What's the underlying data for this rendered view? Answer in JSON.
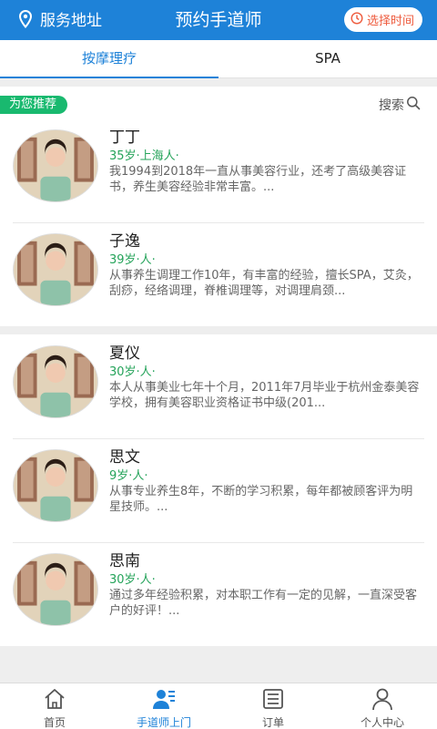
{
  "header": {
    "location_label": "服务地址",
    "title": "预约手道师",
    "time_button_label": "选择时间",
    "location_icon": "location-pin-icon",
    "clock_icon": "clock-icon",
    "accent_color": "#1e82d8"
  },
  "tabs": [
    {
      "label": "按摩理疗",
      "active": true
    },
    {
      "label": "SPA",
      "active": false
    }
  ],
  "recommend": {
    "badge_label": "为您推荐",
    "search_label": "搜索",
    "badge_color": "#19b96f"
  },
  "therapists": [
    {
      "name": "丁丁",
      "meta": "35岁·上海人·",
      "description": "我1994到2018年一直从事美容行业，还考了高级美容证书，养生美容经验非常丰富。..."
    },
    {
      "name": "子逸",
      "meta": "39岁·人·",
      "description": "从事养生调理工作10年，有丰富的经验，擅长SPA，艾灸，刮痧，经络调理，脊椎调理等，对调理肩颈..."
    },
    {
      "name": "夏仪",
      "meta": "30岁·人·",
      "description": "本人从事美业七年十个月，2011年7月毕业于杭州金泰美容学校，拥有美容职业资格证书中级(201..."
    },
    {
      "name": "思文",
      "meta": "9岁·人·",
      "description": "从事专业养生8年，不断的学习积累，每年都被顾客评为明星技师。..."
    },
    {
      "name": "思南",
      "meta": "30岁·人·",
      "description": "通过多年经验积累，对本职工作有一定的见解，一直深受客户的好评！..."
    }
  ],
  "bottom_nav": [
    {
      "label": "首页",
      "icon": "home-icon",
      "active": false
    },
    {
      "label": "手道师上门",
      "icon": "therapist-visit-icon",
      "active": true
    },
    {
      "label": "订单",
      "icon": "order-list-icon",
      "active": false
    },
    {
      "label": "个人中心",
      "icon": "user-profile-icon",
      "active": false
    }
  ]
}
